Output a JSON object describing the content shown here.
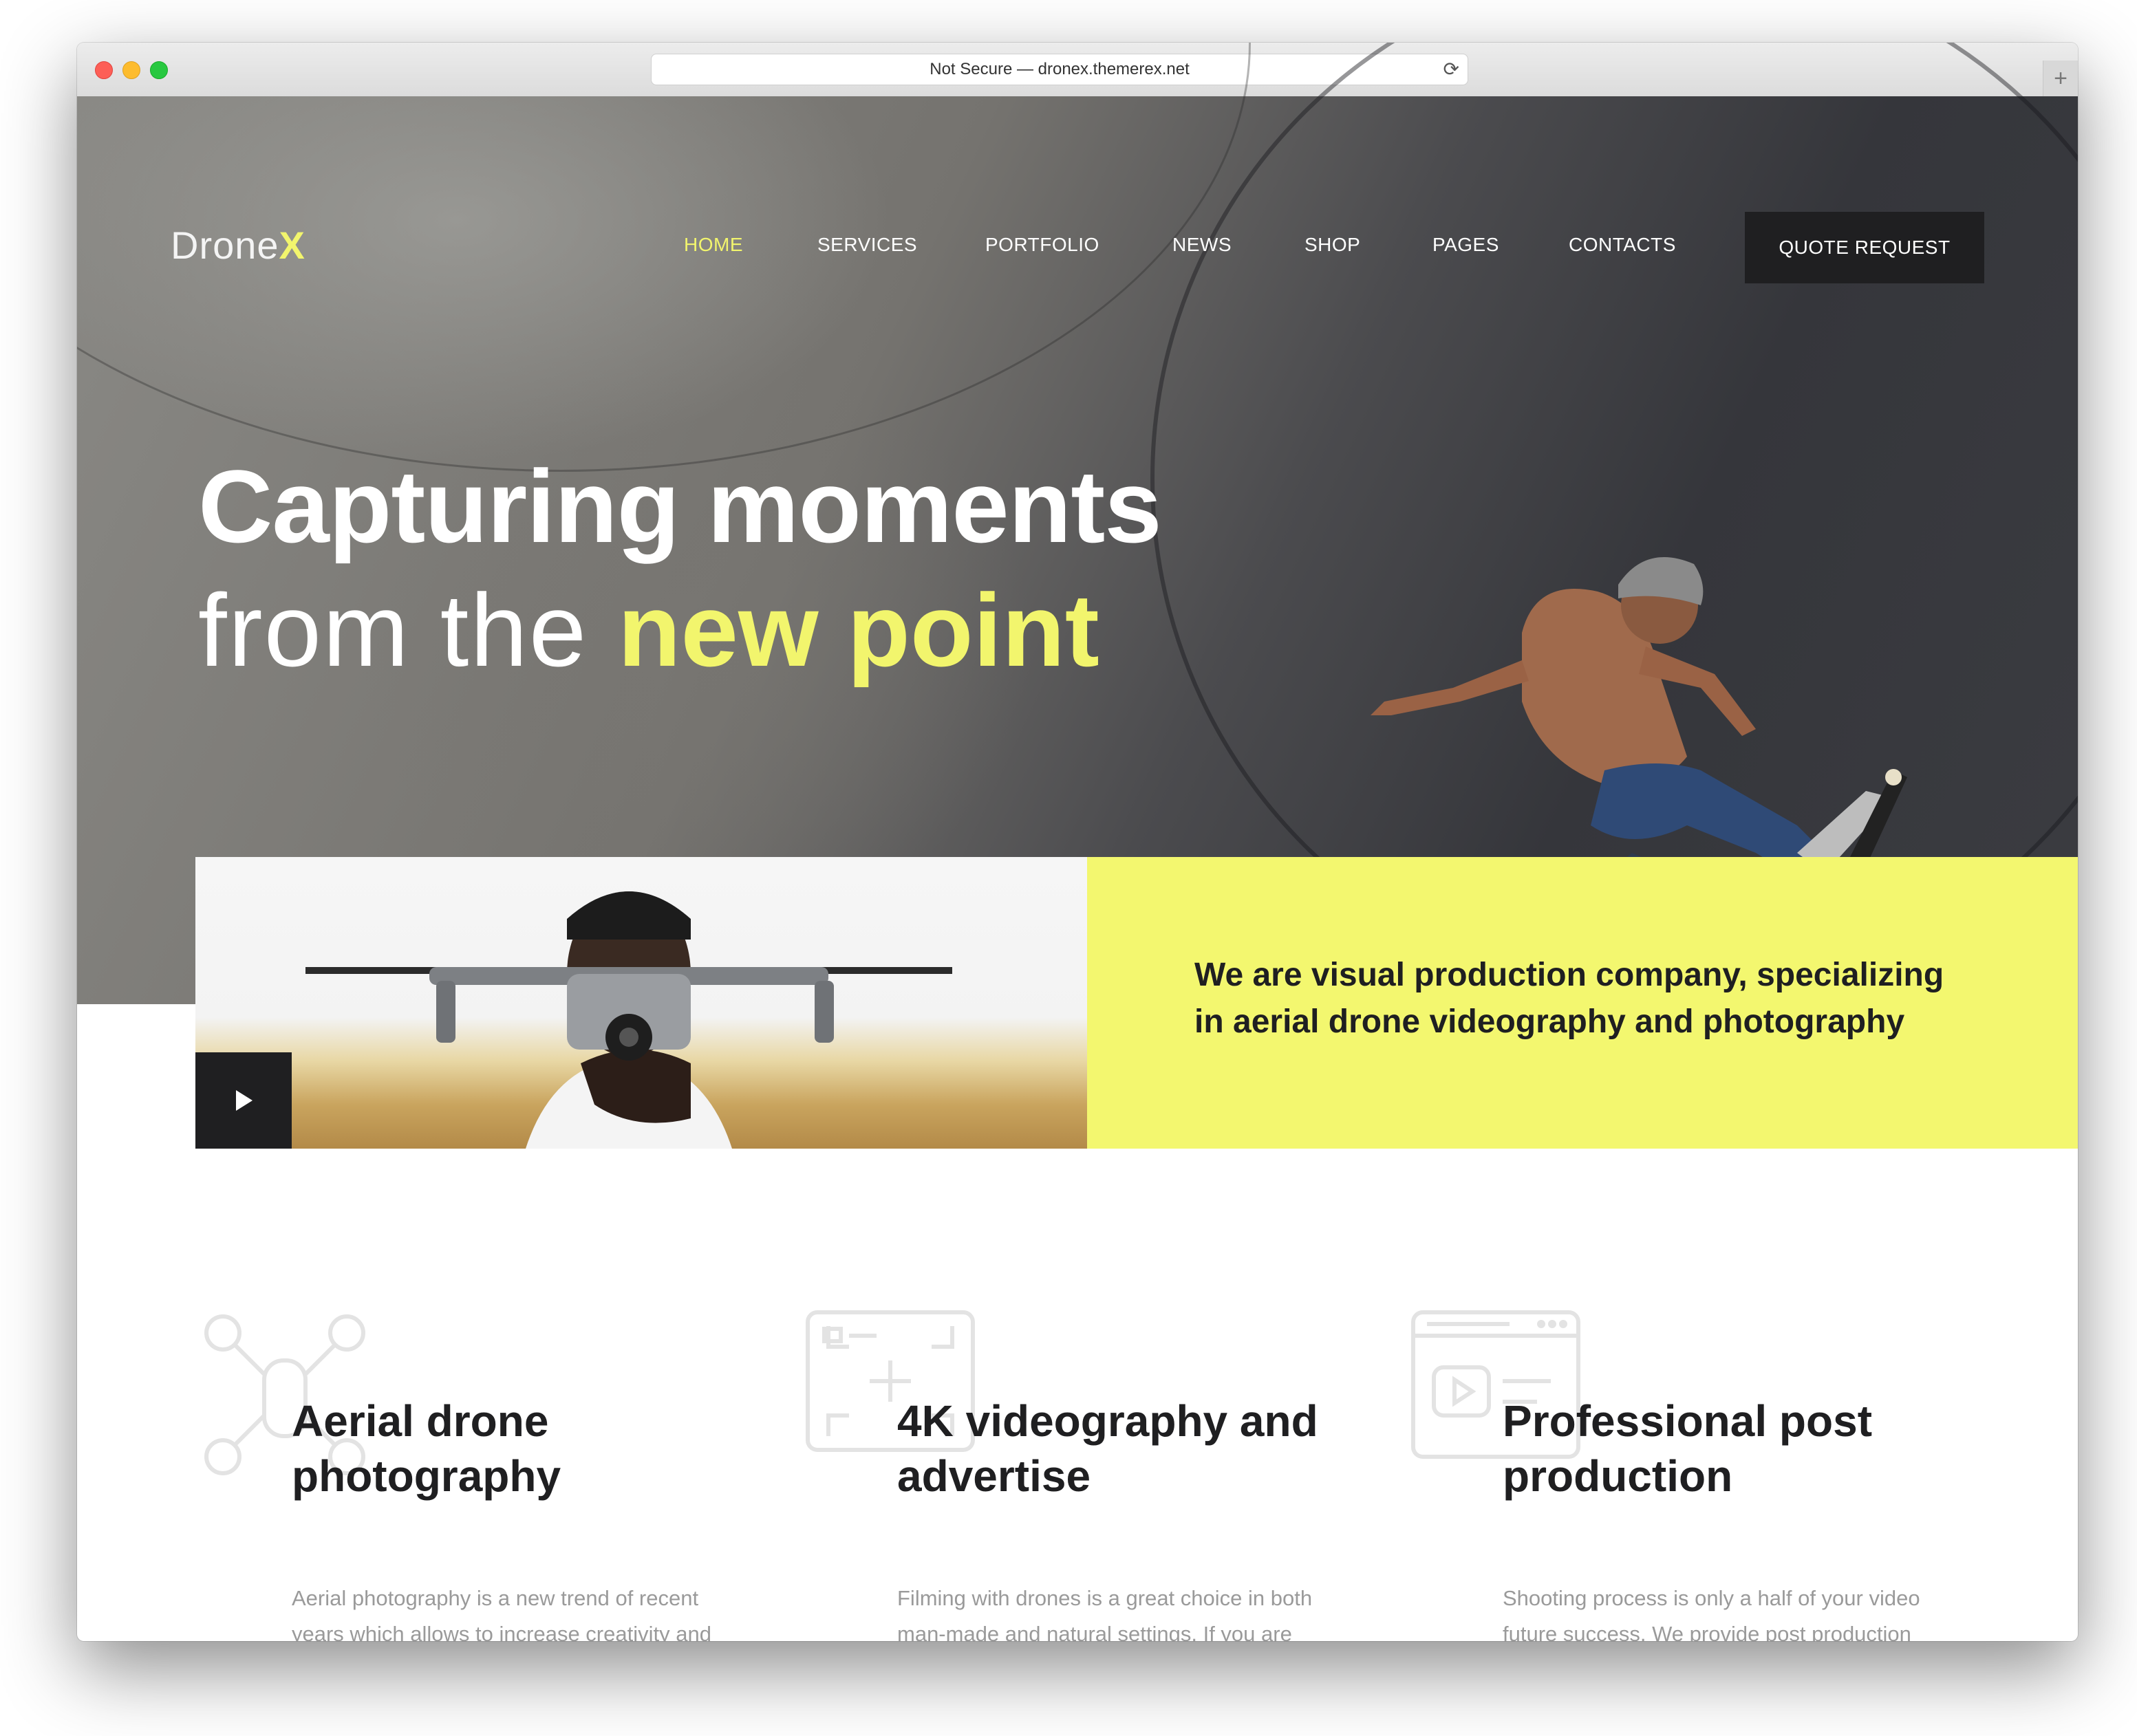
{
  "browser": {
    "url_text": "Not Secure — dronex.themerex.net",
    "reload_icon": "reload-icon",
    "new_tab_icon": "plus-icon"
  },
  "header": {
    "logo_text": "Drone",
    "logo_accent": "X",
    "nav": [
      {
        "label": "HOME",
        "active": true
      },
      {
        "label": "SERVICES"
      },
      {
        "label": "PORTFOLIO"
      },
      {
        "label": "NEWS"
      },
      {
        "label": "SHOP"
      },
      {
        "label": "PAGES"
      },
      {
        "label": "CONTACTS"
      }
    ],
    "cta_label": "QUOTE REQUEST"
  },
  "hero": {
    "line1": "Capturing moments",
    "line2_thin": "from the ",
    "line2_accent": "new point"
  },
  "intro": {
    "text": "We are visual production company, specializing in aerial drone videography and photography",
    "play_icon": "play-icon"
  },
  "features": [
    {
      "icon": "drone-icon",
      "title": "Aerial drone photography",
      "text": "Aerial photography is a new trend of recent years which allows to increase creativity and diversity of shots...."
    },
    {
      "icon": "camera-frame-icon",
      "title": "4K videography and advertise",
      "text": "Filming with drones is a great choice in both man-made and natural settings. If you are planning to..."
    },
    {
      "icon": "video-player-icon",
      "title": "Professional post production",
      "text": "Shooting process is only a half of your video future success. We provide post production services of any..."
    }
  ],
  "colors": {
    "accent": "#f2f56d",
    "dark": "#1f1f21",
    "muted_text": "#9a9a9a"
  }
}
